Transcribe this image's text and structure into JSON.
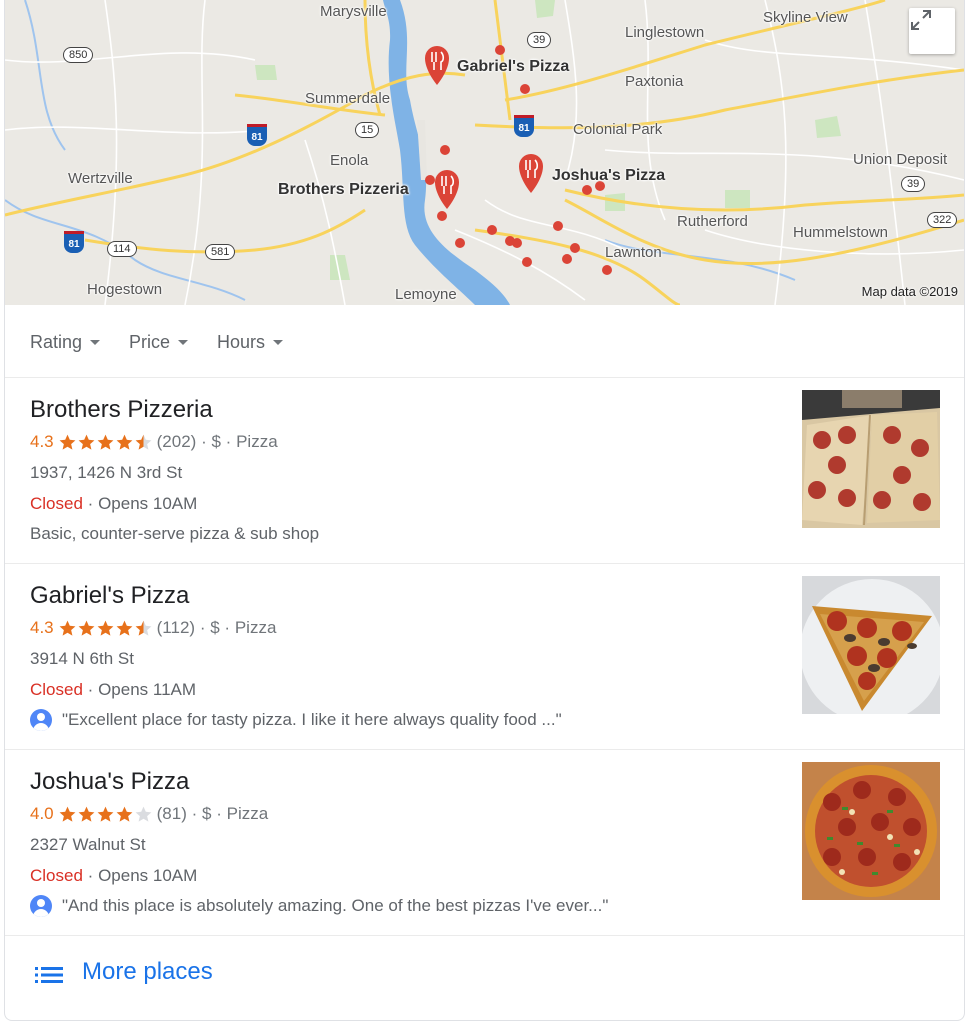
{
  "map": {
    "attribution": "Map data ©2019",
    "places": {
      "marysville": "Marysville",
      "linglestown": "Linglestown",
      "skyline_view": "Skyline View",
      "summerdale": "Summerdale",
      "paxtonia": "Paxtonia",
      "colonial_park": "Colonial Park",
      "enola": "Enola",
      "wertzville": "Wertzville",
      "union_deposit": "Union Deposit",
      "rutherford": "Rutherford",
      "hummelstown": "Hummelstown",
      "lawnton": "Lawnton",
      "hogestown": "Hogestown",
      "lemoyne": "Lemoyne"
    },
    "routes": {
      "r850": "850",
      "r39a": "39",
      "r15": "15",
      "r81a": "81",
      "r81b": "81",
      "r81c": "81",
      "r39b": "39",
      "r322": "322",
      "r114": "114",
      "r581": "581"
    },
    "pins": {
      "gabriels": "Gabriel's Pizza",
      "brothers": "Brothers Pizzeria",
      "joshuas": "Joshua's Pizza"
    },
    "pin_color": "#db4437"
  },
  "filters": [
    {
      "label": "Rating"
    },
    {
      "label": "Price"
    },
    {
      "label": "Hours"
    }
  ],
  "listings": [
    {
      "name": "Brothers Pizzeria",
      "score": "4.3",
      "rating": 4.3,
      "reviews": "(202)",
      "price": "$",
      "category": "Pizza",
      "address": "1937, 1426 N 3rd St",
      "status": "Closed",
      "hours": "Opens 10AM",
      "extra": "Basic, counter-serve pizza & sub shop"
    },
    {
      "name": "Gabriel's Pizza",
      "score": "4.3",
      "rating": 4.3,
      "reviews": "(112)",
      "price": "$",
      "category": "Pizza",
      "address": "3914 N 6th St",
      "status": "Closed",
      "hours": "Opens 11AM",
      "extra": "\"Excellent place for tasty pizza. I like it here always quality food ...\""
    },
    {
      "name": "Joshua's Pizza",
      "score": "4.0",
      "rating": 4.0,
      "reviews": "(81)",
      "price": "$",
      "category": "Pizza",
      "address": "2327 Walnut St",
      "status": "Closed",
      "hours": "Opens 10AM",
      "extra": "\"And this place is absolutely amazing. One of the best pizzas I've ever...\""
    }
  ],
  "sep": "·",
  "more": {
    "label": "More places"
  },
  "colors": {
    "star": "#e7711b",
    "closed": "#d93025",
    "link": "#1a73e8"
  }
}
